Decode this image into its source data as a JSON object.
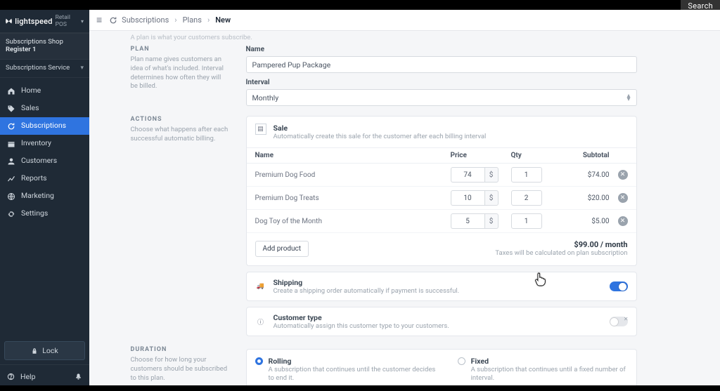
{
  "global_search_label": "Search",
  "brand": {
    "wordmark": "lightspeed",
    "sublabel": "Retail POS"
  },
  "shop": {
    "name": "Subscriptions Shop",
    "register": "Register 1"
  },
  "service_selector": "Subscriptions Service",
  "sidebar": {
    "items": [
      {
        "id": "home",
        "label": "Home"
      },
      {
        "id": "sales",
        "label": "Sales"
      },
      {
        "id": "subscriptions",
        "label": "Subscriptions"
      },
      {
        "id": "inventory",
        "label": "Inventory"
      },
      {
        "id": "customers",
        "label": "Customers"
      },
      {
        "id": "reports",
        "label": "Reports"
      },
      {
        "id": "marketing",
        "label": "Marketing"
      },
      {
        "id": "settings",
        "label": "Settings"
      }
    ],
    "lock_label": "Lock",
    "help_label": "Help"
  },
  "breadcrumbs": {
    "root": "Subscriptions",
    "mid": "Plans",
    "leaf": "New"
  },
  "truncated_note": "A plan is what your customers subscribe.",
  "sections": {
    "plan": {
      "title": "PLAN",
      "desc": "Plan name gives customers an idea of what's included. Interval determines how often they will be billed.",
      "name_label": "Name",
      "name_value": "Pampered Pup Package",
      "interval_label": "Interval",
      "interval_value": "Monthly"
    },
    "actions": {
      "title": "ACTIONS",
      "desc": "Choose what happens after each successful automatic billing.",
      "sale": {
        "title": "Sale",
        "sub": "Automatically create this sale for the customer after each billing interval"
      },
      "table": {
        "headers": {
          "name": "Name",
          "price": "Price",
          "qty": "Qty",
          "subtotal": "Subtotal"
        },
        "currency_symbol": "$",
        "rows": [
          {
            "name": "Premium Dog Food",
            "price": "74",
            "qty": "1",
            "subtotal": "$74.00"
          },
          {
            "name": "Premium Dog Treats",
            "price": "10",
            "qty": "2",
            "subtotal": "$20.00"
          },
          {
            "name": "Dog Toy of the Month",
            "price": "5",
            "qty": "1",
            "subtotal": "$5.00"
          }
        ],
        "add_label": "Add product",
        "total": "$99.00 / month",
        "tax_note": "Taxes will be calculated on plan subscription"
      },
      "shipping": {
        "title": "Shipping",
        "sub": "Create a shipping order automatically if payment is successful.",
        "on": true
      },
      "customer_type": {
        "title": "Customer type",
        "sub": "Automatically assign this customer type to your customers.",
        "on": false
      }
    },
    "duration": {
      "title": "DURATION",
      "desc": "Choose for how long your customers should be subscribed to this plan.",
      "rolling": {
        "name": "Rolling",
        "desc": "A subscription that continues until the customer decides to end it."
      },
      "fixed": {
        "name": "Fixed",
        "desc": "A subscription that continues until a fixed number of interval."
      },
      "selected": "rolling"
    }
  }
}
